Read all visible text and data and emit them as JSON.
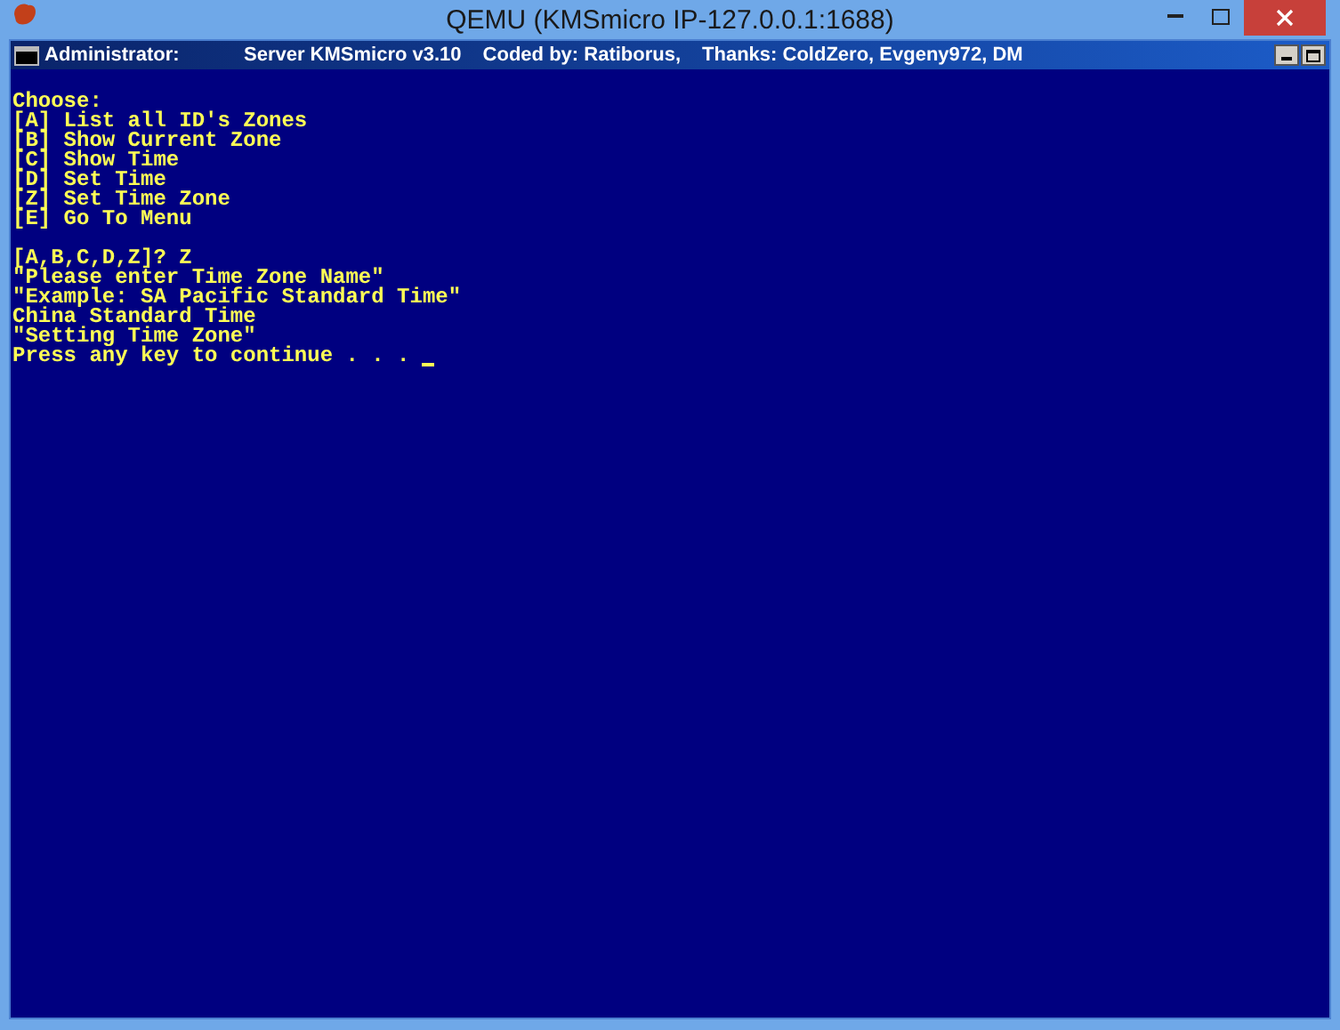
{
  "window": {
    "title": "QEMU (KMSmicro IP-127.0.0.1:1688)"
  },
  "console": {
    "title_parts": [
      "Administrator:",
      "Server KMSmicro v3.10",
      "Coded by: Ratiborus,",
      "Thanks: ColdZero, Evgeny972, DM"
    ],
    "blocks": [
      [
        "Choose:",
        "[A] List all ID's Zones",
        "[B] Show Current Zone",
        "[C] Show Time",
        "[D] Set Time",
        "[Z] Set Time Zone",
        "[E] Go To Menu"
      ],
      [
        "[A,B,C,D,Z]? Z",
        "\"Please enter Time Zone Name\"",
        "\"Example: SA Pacific Standard Time\"",
        "China Standard Time",
        "\"Setting Time Zone\"",
        "Press any key to continue . . . "
      ]
    ]
  }
}
